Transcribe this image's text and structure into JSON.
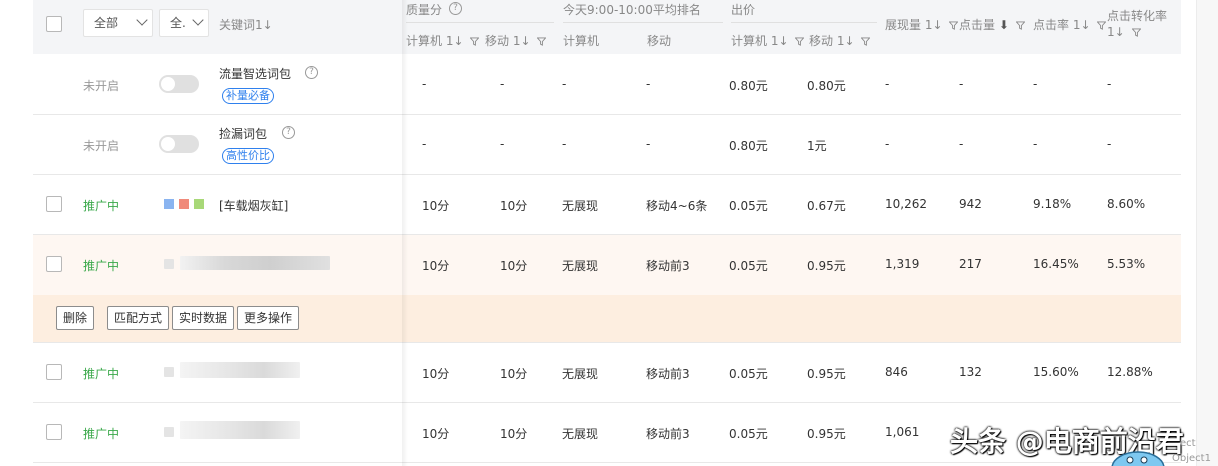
{
  "header": {
    "dropdown_all": "全部",
    "dropdown_all2": "全.",
    "keyword_label": "关键词",
    "quality_label": "质量分",
    "rank_label": "今天9:00-10:00平均排名",
    "bid_label": "出价",
    "pc_label": "计算机",
    "mobile_label": "移动",
    "impressions_label": "展现量",
    "clicks_label": "点击量",
    "ctr_label": "点击率",
    "cvr_label_1": "点击转化率",
    "sort_glyph": "1↓"
  },
  "rows": [
    {
      "status": "未开启",
      "keyword": "流量智选词包",
      "tag": "补量必备",
      "q_pc": "-",
      "q_mobile": "-",
      "rank_pc": "-",
      "rank_mobile": "-",
      "bid_pc": "0.80元",
      "bid_mobile": "0.80元",
      "impressions": "-",
      "clicks": "-",
      "ctr": "-",
      "cvr": "-"
    },
    {
      "status": "未开启",
      "keyword": "捡漏词包",
      "tag": "高性价比",
      "q_pc": "-",
      "q_mobile": "-",
      "rank_pc": "-",
      "rank_mobile": "-",
      "bid_pc": "0.80元",
      "bid_mobile": "1元",
      "impressions": "-",
      "clicks": "-",
      "ctr": "-",
      "cvr": "-"
    },
    {
      "status": "推广中",
      "keyword": "[车载烟灰缸]",
      "q_pc": "10分",
      "q_mobile": "10分",
      "rank_pc": "无展现",
      "rank_mobile": "移动4~6条",
      "bid_pc": "0.05元",
      "bid_mobile": "0.67元",
      "impressions": "10,262",
      "clicks": "942",
      "ctr": "9.18%",
      "cvr": "8.60%"
    },
    {
      "status": "推广中",
      "q_pc": "10分",
      "q_mobile": "10分",
      "rank_pc": "无展现",
      "rank_mobile": "移动前3",
      "bid_pc": "0.05元",
      "bid_mobile": "0.95元",
      "impressions": "1,319",
      "clicks": "217",
      "ctr": "16.45%",
      "cvr": "5.53%"
    },
    {
      "status": "推广中",
      "q_pc": "10分",
      "q_mobile": "10分",
      "rank_pc": "无展现",
      "rank_mobile": "移动前3",
      "bid_pc": "0.05元",
      "bid_mobile": "0.95元",
      "impressions": "846",
      "clicks": "132",
      "ctr": "15.60%",
      "cvr": "12.88%"
    },
    {
      "status": "推广中",
      "q_pc": "10分",
      "q_mobile": "10分",
      "rank_pc": "无展现",
      "rank_mobile": "移动前3",
      "bid_pc": "0.05元",
      "bid_mobile": "0.95元",
      "impressions": "1,061"
    }
  ],
  "actions": {
    "delete": "删除",
    "match": "匹配方式",
    "realtime": "实时数据",
    "more": "更多操作"
  },
  "watermark": {
    "text": "头条 @电商前沿君",
    "obj1": "ect",
    "obj2": "Object1"
  },
  "colors": {
    "status_on": "#3aa84a",
    "tag_blue": "#2f80ed",
    "sq_blue": "#8ab4f0",
    "sq_red": "#f08a7a",
    "sq_green": "#a8d878",
    "highlight_row": "#fef7f2",
    "action_row": "#fdeee0"
  }
}
